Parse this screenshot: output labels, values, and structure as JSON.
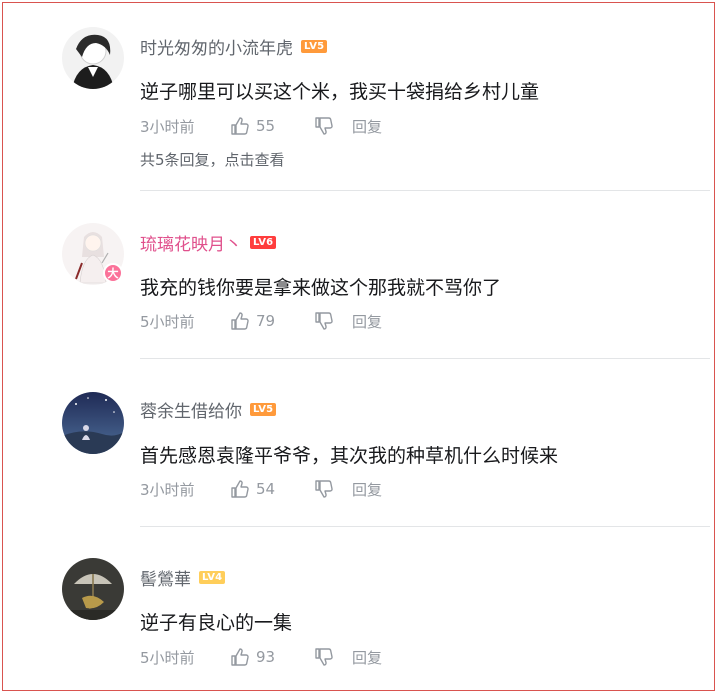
{
  "comments": [
    {
      "username": "时光匆匆的小流年虎",
      "level": "LV5",
      "content": "逆子哪里可以买这个米，我买十袋捐给乡村儿童",
      "time": "3小时前",
      "likes": "55",
      "reply_label": "回复",
      "more_replies": "共5条回复，点击查看"
    },
    {
      "username": "琉璃花映月丶",
      "level": "LV6",
      "badge": "大",
      "content": "我充的钱你要是拿来做这个那我就不骂你了",
      "time": "5小时前",
      "likes": "79",
      "reply_label": "回复"
    },
    {
      "username": "蓉余生借给你",
      "level": "LV5",
      "content": "首先感恩袁隆平爷爷，其次我的种草机什么时候来",
      "time": "3小时前",
      "likes": "54",
      "reply_label": "回复"
    },
    {
      "username": "髻鶯華",
      "level": "LV4",
      "content": "逆子有良心的一集",
      "time": "5小时前",
      "likes": "93",
      "reply_label": "回复"
    }
  ],
  "colors": {
    "lv5": "#ff9a3b",
    "lv6": "#ff3d3d",
    "lv4": "#ffce5a",
    "vip_name": "#e0508c",
    "frame_border": "#d9534f"
  }
}
